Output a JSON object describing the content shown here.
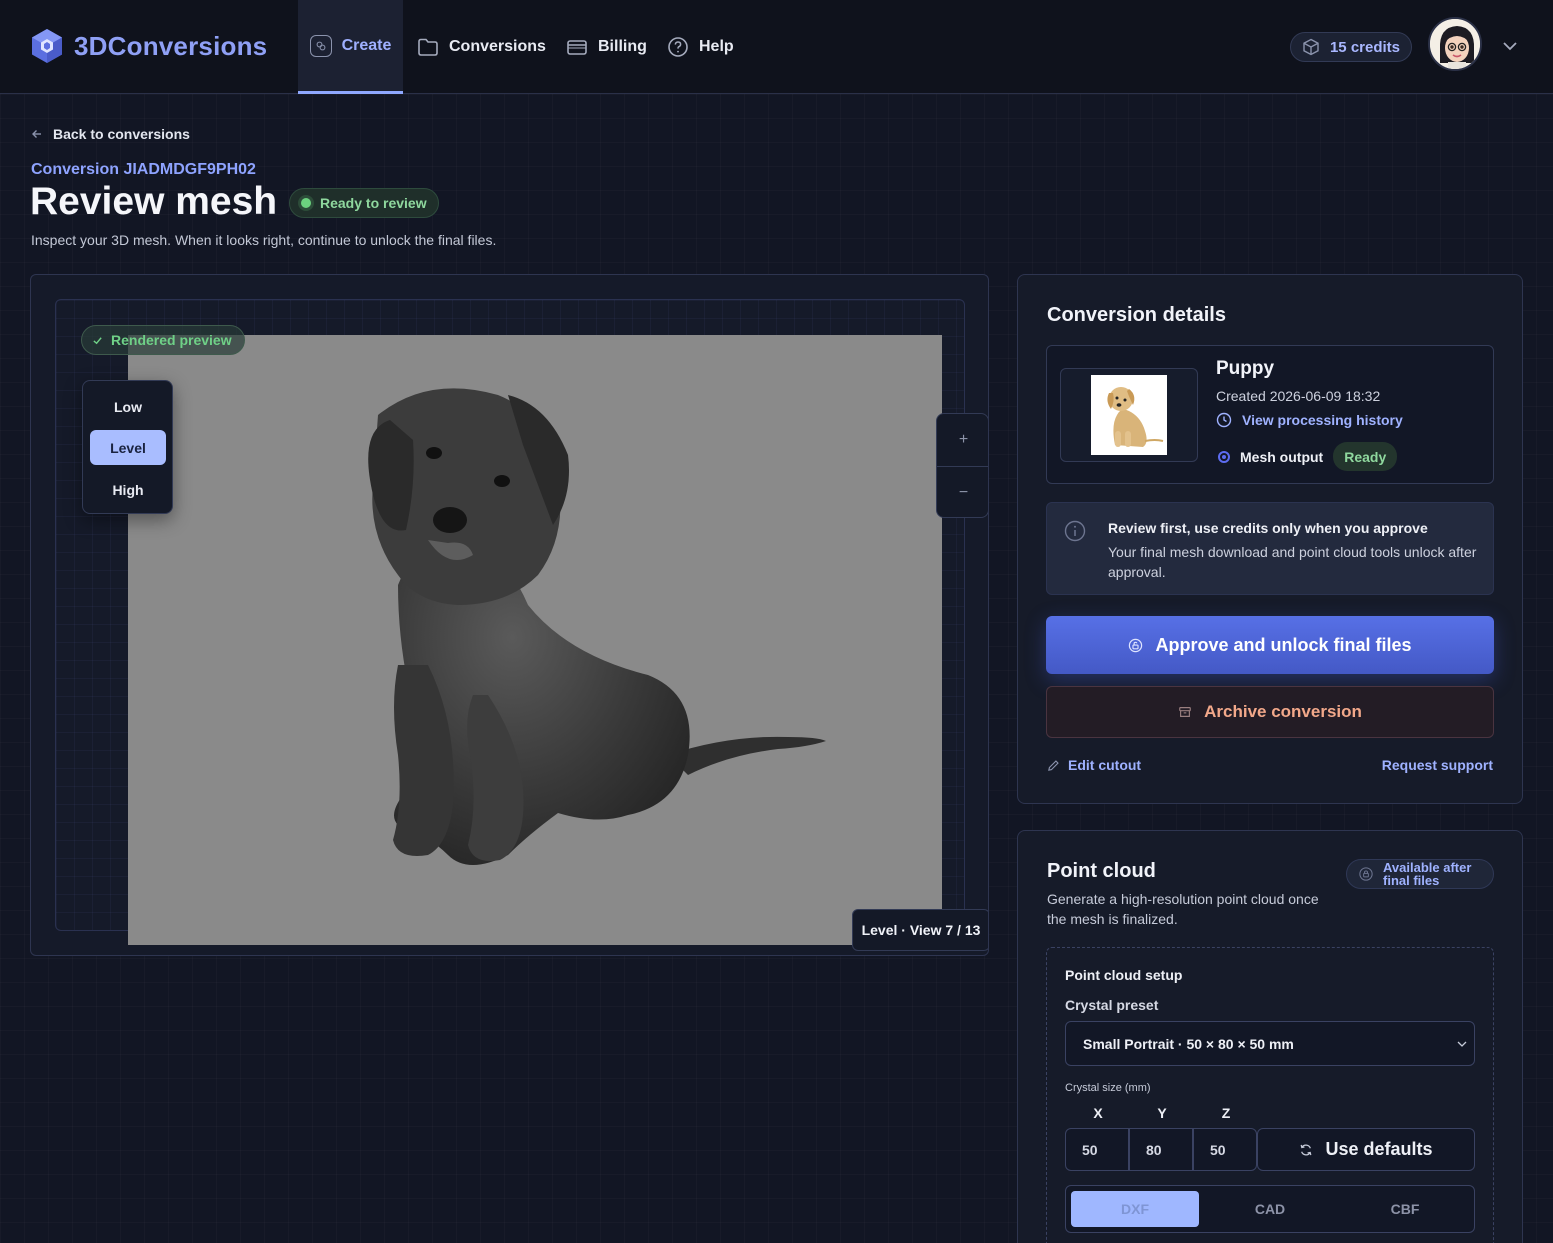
{
  "brand": {
    "name": "3DConversions"
  },
  "nav": {
    "items": [
      {
        "label": "Create",
        "active": true,
        "icon": "create-icon"
      },
      {
        "label": "Conversions",
        "icon": "folder-icon"
      },
      {
        "label": "Billing",
        "icon": "card-icon"
      },
      {
        "label": "Help",
        "icon": "help-icon"
      }
    ],
    "credits": "15 credits"
  },
  "header": {
    "back": "Back to conversions",
    "conversion_id": "Conversion JIADMDGF9PH02",
    "title": "Review mesh",
    "status": "Ready to review",
    "subtitle": "Inspect your 3D mesh. When it looks right, continue to unlock the final files."
  },
  "viewer": {
    "rendered_label": "Rendered preview",
    "quality_options": [
      "Low",
      "Level",
      "High"
    ],
    "quality_selected": "Level",
    "zoom_in": "+",
    "zoom_out": "−",
    "view_badge": "Level · View 7 / 13"
  },
  "details": {
    "title": "Conversion details",
    "asset_name": "Puppy",
    "created": "Created 2026-06-09 18:32",
    "history_link": "View processing history",
    "mesh_label": "Mesh output",
    "mesh_status": "Ready",
    "info_title": "Review first, use credits only when you approve",
    "info_body": "Your final mesh download and point cloud tools unlock after approval.",
    "approve_button": "Approve and unlock final files",
    "archive_button": "Archive conversion",
    "edit_cutout": "Edit cutout",
    "request_support": "Request support"
  },
  "point_cloud": {
    "title": "Point cloud",
    "availability": "Available after final files",
    "description": "Generate a high-resolution point cloud once the mesh is finalized.",
    "setup_title": "Point cloud setup",
    "preset_label": "Crystal preset",
    "preset_value": "Small Portrait · 50 × 80 × 50 mm",
    "size_label": "Crystal size (mm)",
    "axes": {
      "x": "X",
      "y": "Y",
      "z": "Z"
    },
    "dims": {
      "x": "50",
      "y": "80",
      "z": "50"
    },
    "defaults_button": "Use defaults",
    "formats": [
      "DXF",
      "CAD",
      "CBF"
    ],
    "format_selected": "DXF"
  },
  "colors": {
    "accent": "#8fa8ff",
    "primary_button": "#4f66d8",
    "success": "#8fd89e",
    "danger_text": "#f2a88a"
  }
}
